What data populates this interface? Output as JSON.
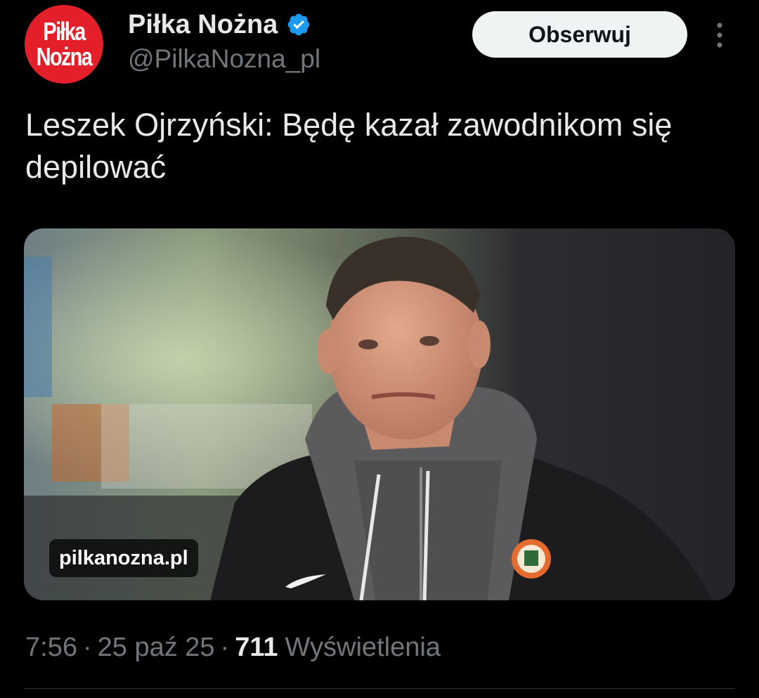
{
  "author": {
    "avatar_text_line1": "Piłka",
    "avatar_text_line2": "Nożna",
    "display_name": "Piłka Nożna",
    "handle": "@PilkaNozna_pl",
    "verified_icon": "verified-badge-icon"
  },
  "actions": {
    "follow_label": "Obserwuj",
    "more_icon": "more-vertical-icon"
  },
  "tweet": {
    "text": "Leszek Ojrzyński: Będę kazał zawodnikom się depilować"
  },
  "media": {
    "domain": "pilkanozna.pl",
    "image_subject": "photo-of-coach"
  },
  "meta": {
    "time": "7:56",
    "separator": "·",
    "date": "25 paź 25",
    "views_count": "711",
    "views_label": "Wyświetlenia"
  },
  "colors": {
    "background": "#000000",
    "text_primary": "#e7e9ea",
    "text_secondary": "#71767b",
    "verified_blue": "#1d9bf0",
    "avatar_red": "#e3202a",
    "follow_button_bg": "#eff3f4",
    "divider": "#2f3336"
  }
}
